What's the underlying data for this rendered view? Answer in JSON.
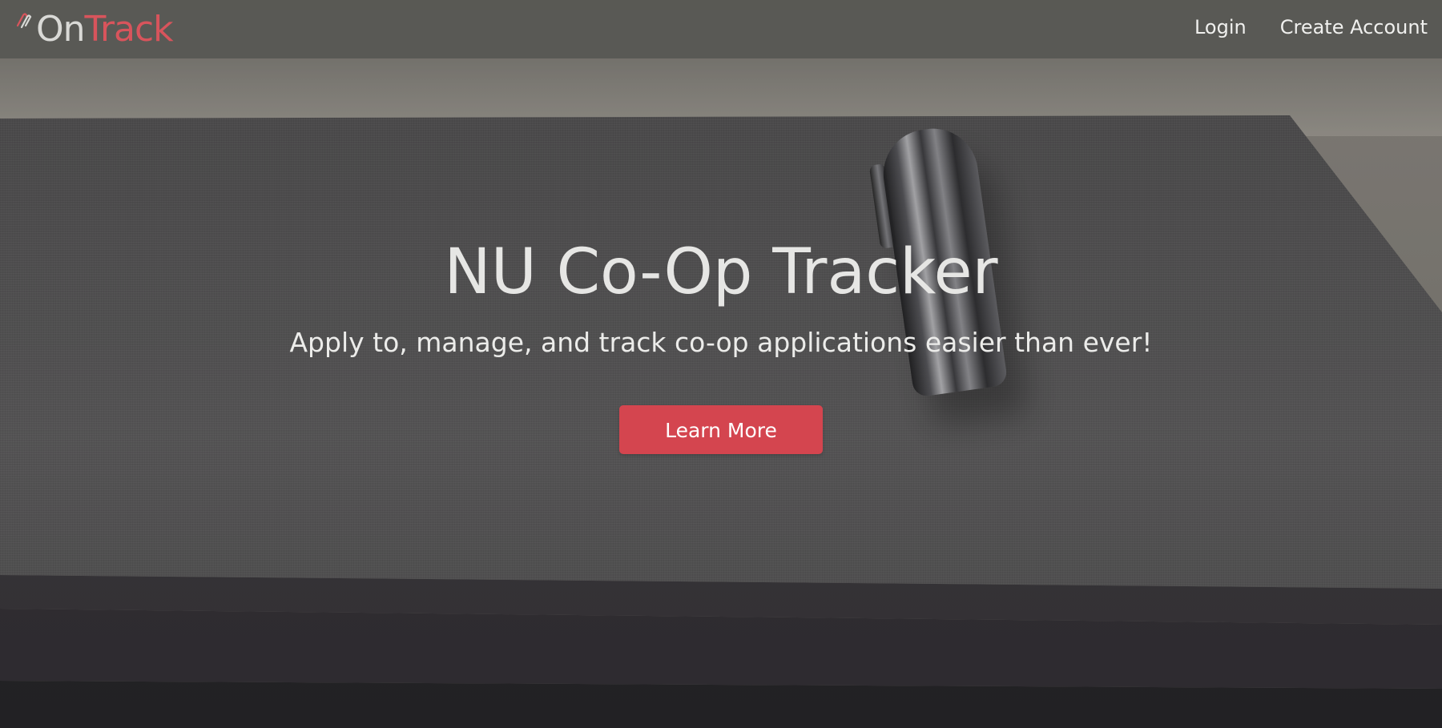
{
  "navbar": {
    "brand": {
      "part1": "On",
      "part2": "Track",
      "icon": "paperclip-logo-icon"
    },
    "links": [
      {
        "label": "Login"
      },
      {
        "label": "Create Account"
      }
    ]
  },
  "hero": {
    "title": "NU Co-Op Tracker",
    "subtitle": "Apply to, manage, and track co-op applications easier than ever!",
    "cta_label": "Learn More"
  },
  "colors": {
    "accent": "#d4454f",
    "brand_secondary": "#d8545c",
    "navbar_bg": "#585854"
  }
}
